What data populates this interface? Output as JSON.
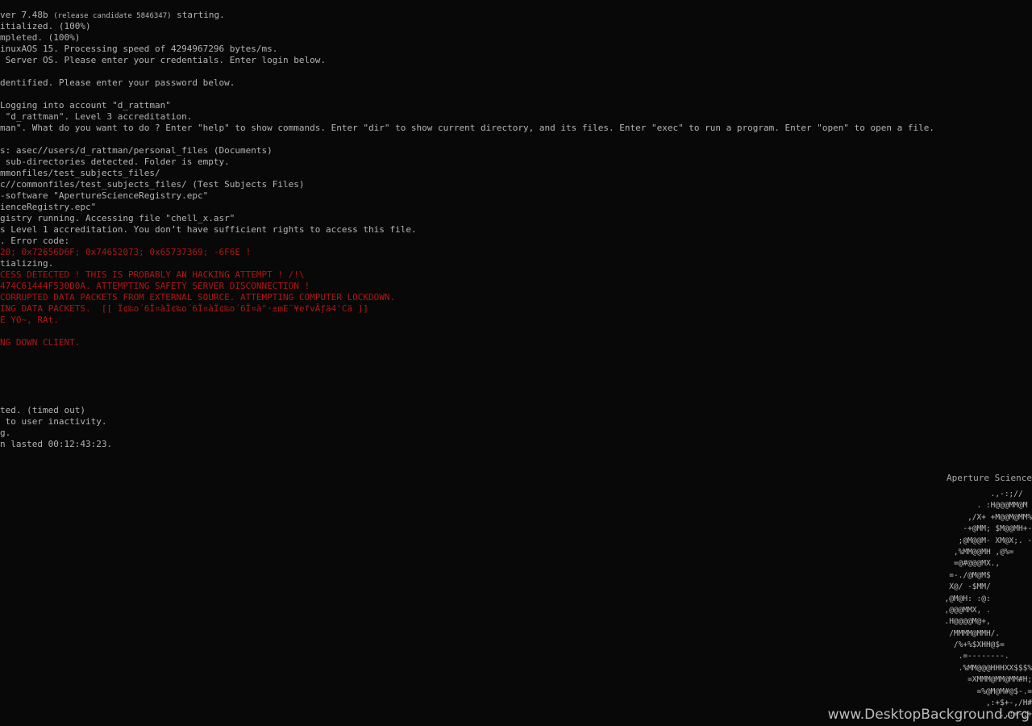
{
  "terminal": {
    "lines": [
      {
        "pre": "ver 7.48b ",
        "note": "(release candidate 5846347)",
        "post": " starting.",
        "color": "gray"
      },
      {
        "text": "itialized. (100%)",
        "color": "gray"
      },
      {
        "text": "mpleted. (100%)",
        "color": "gray"
      },
      {
        "text": "inuxAOS 15. Processing speed of 4294967296 bytes/ms.",
        "color": "gray"
      },
      {
        "text": " Server OS. Please enter your credentials. Enter login below.",
        "color": "gray"
      },
      {
        "text": "",
        "color": "gray"
      },
      {
        "text": "dentified. Please enter your password below.",
        "color": "gray"
      },
      {
        "text": "",
        "color": "gray"
      },
      {
        "text": "Logging into account \"d_rattman\"",
        "color": "gray"
      },
      {
        "text": " \"d_rattman\". Level 3 accreditation.",
        "color": "gray"
      },
      {
        "text": "man\". What do you want to do ? Enter \"help\" to show commands. Enter \"dir\" to show current directory, and its files. Enter \"exec\" to run a program. Enter \"open\" to open a file.",
        "color": "gray"
      },
      {
        "text": "",
        "color": "gray"
      },
      {
        "text": "s: asec//users/d_rattman/personal_files (Documents)",
        "color": "gray"
      },
      {
        "text": " sub-directories detected. Folder is empty.",
        "color": "gray"
      },
      {
        "text": "mmonfiles/test_subjects_files/",
        "color": "gray"
      },
      {
        "text": "c//commonfiles/test_subjects_files/ (Test Subjects Files)",
        "color": "gray"
      },
      {
        "text": "-software \"ApertureScienceRegistry.epc\"",
        "color": "gray"
      },
      {
        "text": "ienceRegistry.epc\"",
        "color": "gray"
      },
      {
        "text": "gistry running. Accessing file \"chell_x.asr\"",
        "color": "gray"
      },
      {
        "text": "s Level 1 accreditation. You don’t have sufficient rights to access this file.",
        "color": "gray"
      },
      {
        "text": ". Error code:",
        "color": "gray"
      },
      {
        "text": "20; 0x72656D6F; 0x74652073; 0x65737369; -6F6E !",
        "color": "red"
      },
      {
        "text": "tializing.",
        "color": "gray"
      },
      {
        "text": "CESS DETECTED ! THIS IS PROBABLY AN HACKING ATTEMPT ! /!\\",
        "color": "red"
      },
      {
        "text": "474C61444F530D0A. ATTEMPTING SAFETY SERVER DISCONNECTION !",
        "color": "red"
      },
      {
        "text": "CORRUPTED DATA PACKETS FROM EXTERNAL SOURCE. ATTEMPTING COMPUTER LOCKDOWN.",
        "color": "red"
      },
      {
        "text": "ING DATA PACKETS.  [[ Ï¢‰o´6Ï¤àÏ¢‰o´6Ï¤àÏ¢‰o´6Ï¤à\"·±mE¨¥efvÂƒä4'Cä ]]",
        "color": "red"
      },
      {
        "text": "E YO~, RAt.",
        "color": "red"
      },
      {
        "text": "",
        "color": "gray"
      },
      {
        "text": "NG DOWN CLIENT.",
        "color": "red"
      },
      {
        "text": "",
        "color": "gray"
      },
      {
        "text": "",
        "color": "gray"
      },
      {
        "text": "",
        "color": "gray"
      },
      {
        "text": "",
        "color": "gray"
      },
      {
        "text": "",
        "color": "gray"
      },
      {
        "text": "ted. (timed out)",
        "color": "gray"
      },
      {
        "text": " to user inactivity.",
        "color": "gray"
      },
      {
        "text": "g.",
        "color": "gray"
      },
      {
        "text": "n lasted 00:12:43:23.",
        "color": "gray"
      }
    ]
  },
  "logo": {
    "title": "Aperture Science",
    "ascii_lines": [
      "                   .,-:;//",
      "                . :H@@@MM@M",
      "              ,/X+ +M@@M@MM%",
      "             -+@MM; $M@@MH+-,",
      "            ;@M@@M- XM@X;. -+",
      "           ,%MM@@MH ,@%=",
      "           =@#@@@MX.,",
      "          =-./@M@M$",
      "          X@/ -$MM/",
      "         ,@M@H: :@:",
      "         ,@@@MMX, .",
      "         .H@@@@M@+,",
      "          /MMMM@MMH/.",
      "           /%+%$XHH@$=",
      "            .=--------.",
      "            .%MM@@@HHHXX$$$%+-",
      "              =XMMM@MM@MM#H;,-",
      "                =%@M@M#@$-.=$@",
      "                  ,:+$+-,/H#MM",
      "                     .,:=-;+%"
    ]
  },
  "watermark": {
    "text": "www.DesktopBackground.org"
  },
  "colors": {
    "background": "#080808",
    "text": "#b4b4b4",
    "alert": "#b01515"
  }
}
